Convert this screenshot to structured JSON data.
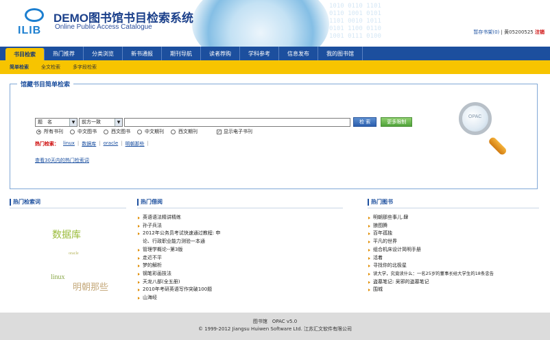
{
  "header": {
    "logo_text": "ILIB",
    "title": "DEMO图书馆书目检索系统",
    "subtitle": "Online Public Access Catalogue",
    "digits": "1010 0110 1101\n0110 1001 0101\n1101 0010 1011\n0101 1100 0110\n1001 0111 0100",
    "cart_label": "暂存书架",
    "cart_count": "(0)",
    "separator": "|",
    "user_label": "黄05200525",
    "logout_label": "注销"
  },
  "nav": {
    "items": [
      "书目检索",
      "热门推荐",
      "分类浏览",
      "新书通报",
      "期刊导航",
      "读者荐购",
      "学科参考",
      "信息发布",
      "我的图书馆"
    ]
  },
  "subnav": {
    "items": [
      "简单检索",
      "全文检索",
      "多字段检索"
    ]
  },
  "search": {
    "panel_title": "馆藏书目简单检索",
    "field_select": "题　名",
    "match_select": "前方一致",
    "query_value": "",
    "search_button": "检 索",
    "more_button": "更多限制",
    "doc_types": [
      "所有书刊",
      "中文图书",
      "西文图书",
      "中文期刊",
      "西文期刊"
    ],
    "selected_doc_type": "所有书刊",
    "ebook_check": "✓",
    "ebook_label": "显示电子书刊",
    "hot_label": "热门检索：",
    "hot_keywords": [
      "linux",
      "数据库",
      "oracle",
      "明朝那些"
    ],
    "hot_sep": "|",
    "recent_link": "查看30天内的热门检索词",
    "magnifier_text": "OPAC"
  },
  "hot_terms": {
    "title": "热门检索词",
    "tags": [
      {
        "text": "数据库",
        "color": "#9abb3a"
      },
      {
        "text": "oracle",
        "color": "#b5b35a"
      },
      {
        "text": "linux",
        "color": "#8aa84a"
      },
      {
        "text": "明朝那些",
        "color": "#c4a87a"
      }
    ]
  },
  "hot_borrow": {
    "title": "热门借阅",
    "items": [
      "英语语法精讲精练",
      "孙子兵法",
      "2012年公务员考试快速通过教程: 申",
      "论、行政职业能力测验一本通",
      "管理学概论--第3版",
      "走近不平",
      "梦的解析",
      "钢笔彩画技法",
      "天龙八部(全五册)",
      "2010年考研英语写作突破100题",
      "山海经"
    ]
  },
  "hot_books": {
    "title": "热门图书",
    "items": [
      "明朝那些事儿.肆",
      "狼图腾",
      "百年孤独",
      "平凡的世界",
      "组合机床设计简明手册",
      "活着",
      "寻找你的北极星",
      "读大学，究竟读什么：一名25岁的董事长给大学生的18条忠告",
      "盗墓笔记: 吴邪的盗墓笔记",
      "围城"
    ]
  },
  "footer": {
    "line1": "图书馆　OPAC v5.0",
    "line2": "© 1999-2012 Jiangsu Huiwen Software Ltd. 江苏汇文软件有限公司"
  }
}
